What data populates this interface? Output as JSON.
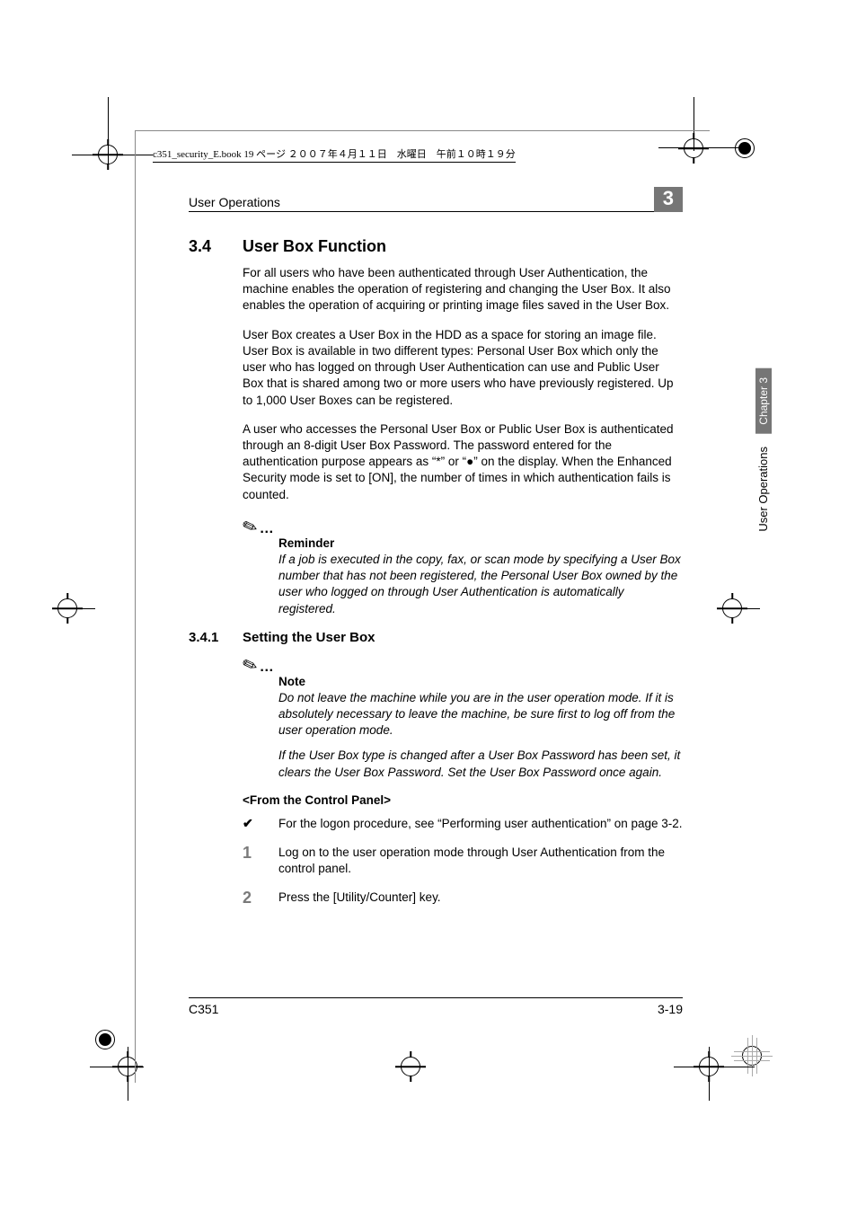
{
  "bookinfo": "c351_security_E.book  19 ページ  ２００７年４月１１日　水曜日　午前１０時１９分",
  "running_head": {
    "left": "User Operations",
    "chapnum": "3"
  },
  "side": {
    "chapter": "Chapter 3",
    "section": "User Operations"
  },
  "h1": {
    "num": "3.4",
    "title": "User Box Function"
  },
  "paras": {
    "p1": "For all users who have been authenticated through User Authentication, the machine enables the operation of registering and changing the User Box. It also enables the operation of acquiring or printing image files saved in the User Box.",
    "p2": "User Box creates a User Box in the HDD as a space for storing an image file. User Box is available in two different types: Personal User Box which only the user who has logged on through User Authentication can use and Public User Box that is shared among two or more users who have previously registered. Up to 1,000 User Boxes can be registered.",
    "p3": "A user who accesses the Personal User Box or Public User Box is authenticated through an 8-digit User Box Password. The password entered for the authentication purpose appears as “*” or “●” on the display. When the Enhanced Security mode is set to [ON], the number of times in which authentication fails is counted."
  },
  "reminder": {
    "head": "Reminder",
    "body": "If a job is executed in the copy, fax, or scan mode by specifying a User Box number that has not been registered, the Personal User Box owned by the user who logged on through User Authentication is automatically registered."
  },
  "h2": {
    "num": "3.4.1",
    "title": "Setting the User Box"
  },
  "note": {
    "head": "Note",
    "b1": "Do not leave the machine while you are in the user operation mode. If it is absolutely necessary to leave the machine, be sure first to log off from the user operation mode.",
    "b2": "If the User Box type is changed after a User Box Password has been set, it clears the User Box Password. Set the User Box Password once again."
  },
  "subhead": "<From the Control Panel>",
  "bullet": {
    "mark": "✔",
    "text": "For the logon procedure, see “Performing user authentication” on page 3-2."
  },
  "steps": {
    "s1": {
      "n": "1",
      "t": "Log on to the user operation mode through User Authentication from the control panel."
    },
    "s2": {
      "n": "2",
      "t": "Press the [Utility/Counter] key."
    }
  },
  "footer": {
    "left": "C351",
    "right": "3-19"
  }
}
